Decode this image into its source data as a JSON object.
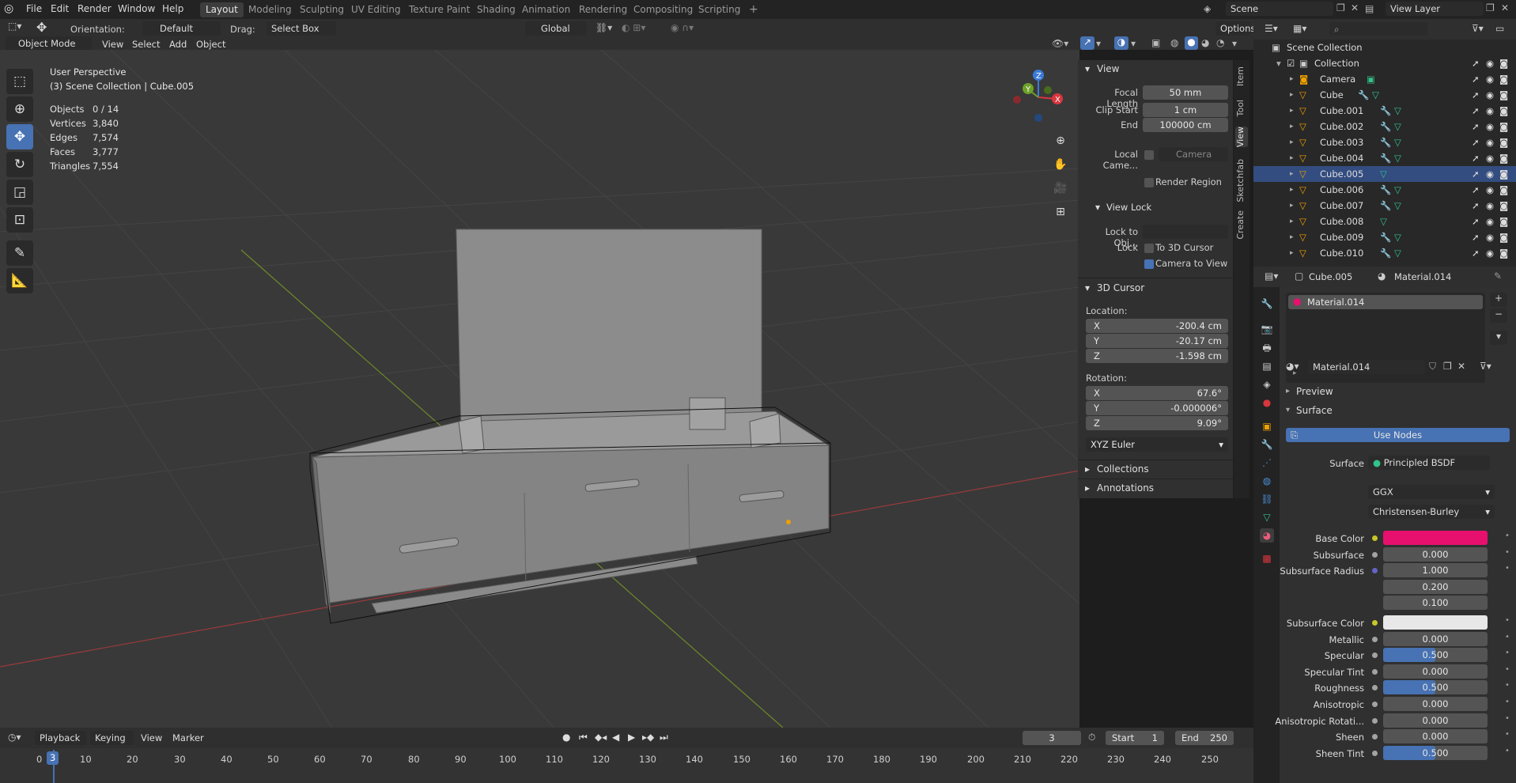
{
  "topbar": {
    "menus": [
      "File",
      "Edit",
      "Render",
      "Window",
      "Help"
    ],
    "workspaces": [
      "Layout",
      "Modeling",
      "Sculpting",
      "UV Editing",
      "Texture Paint",
      "Shading",
      "Animation",
      "Rendering",
      "Compositing",
      "Scripting"
    ],
    "active_workspace": "Layout",
    "add_workspace": "+",
    "scene": "Scene",
    "view_layer": "View Layer"
  },
  "toolsettings": {
    "orientation_label": "Orientation:",
    "orientation_value": "Default",
    "drag_label": "Drag:",
    "drag_value": "Select Box",
    "transform_orientation": "Global",
    "options": "Options"
  },
  "viewport_header": {
    "mode": "Object Mode",
    "menus": [
      "View",
      "Select",
      "Add",
      "Object"
    ]
  },
  "overlay_text": {
    "perspective": "User Perspective",
    "collection": "(3) Scene Collection | Cube.005"
  },
  "stats": [
    {
      "label": "Objects",
      "value": "0 / 14"
    },
    {
      "label": "Vertices",
      "value": "3,840"
    },
    {
      "label": "Edges",
      "value": "7,574"
    },
    {
      "label": "Faces",
      "value": "3,777"
    },
    {
      "label": "Triangles",
      "value": "7,554"
    }
  ],
  "gizmo": {
    "x": "X",
    "y": "Y",
    "z": "Z"
  },
  "npanel": {
    "view_title": "View",
    "focal_length_label": "Focal Length",
    "focal_length": "50 mm",
    "clip_start_label": "Clip Start",
    "clip_start": "1 cm",
    "end_label": "End",
    "end": "100000 cm",
    "local_camera_label": "Local Came...",
    "local_camera_value": "Camera",
    "render_region": "Render Region",
    "view_lock_title": "View Lock",
    "lock_to_obj_label": "Lock to Obj...",
    "lock_label": "Lock",
    "to_3d_cursor": "To 3D Cursor",
    "camera_to_view": "Camera to View",
    "cursor_title": "3D Cursor",
    "location_label": "Location:",
    "loc_x": "-200.4 cm",
    "loc_y": "-20.17 cm",
    "loc_z": "-1.598 cm",
    "rotation_label": "Rotation:",
    "rot_x": "67.6°",
    "rot_y": "-0.000006°",
    "rot_z": "9.09°",
    "rotation_mode": "XYZ Euler",
    "x": "X",
    "y": "Y",
    "z": "Z",
    "collections_title": "Collections",
    "annotations_title": "Annotations",
    "tabs": [
      "Item",
      "Tool",
      "View",
      "Sketchfab",
      "Create"
    ]
  },
  "outliner": {
    "root": "Scene Collection",
    "collection": "Collection",
    "items": [
      "Camera",
      "Cube",
      "Cube.001",
      "Cube.002",
      "Cube.003",
      "Cube.004",
      "Cube.005",
      "Cube.006",
      "Cube.007",
      "Cube.008",
      "Cube.009",
      "Cube.010"
    ]
  },
  "properties": {
    "object_name": "Cube.005",
    "material_name": "Material.014",
    "slot_name": "Material.014",
    "data_block": "Material.014",
    "preview_title": "Preview",
    "surface_title": "Surface",
    "use_nodes": "Use Nodes",
    "surface_label": "Surface",
    "surface_shader": "Principled BSDF",
    "distribution": "GGX",
    "subsurface_method": "Christensen-Burley",
    "rows": [
      {
        "label": "Base Color",
        "value": "",
        "color": "#e8106e"
      },
      {
        "label": "Subsurface",
        "value": "0.000"
      },
      {
        "label": "Subsurface Radius",
        "value": "1.000"
      },
      {
        "label": "",
        "value": "0.200"
      },
      {
        "label": "",
        "value": "0.100"
      },
      {
        "label": "Subsurface Color",
        "value": "",
        "color": "#e8e8e8"
      },
      {
        "label": "Metallic",
        "value": "0.000"
      },
      {
        "label": "Specular",
        "value": "0.500",
        "fill": 0.5
      },
      {
        "label": "Specular Tint",
        "value": "0.000"
      },
      {
        "label": "Roughness",
        "value": "0.500",
        "fill": 0.5
      },
      {
        "label": "Anisotropic",
        "value": "0.000"
      },
      {
        "label": "Anisotropic Rotati...",
        "value": "0.000"
      },
      {
        "label": "Sheen",
        "value": "0.000"
      },
      {
        "label": "Sheen Tint",
        "value": "0.500",
        "fill": 0.5
      }
    ]
  },
  "timeline": {
    "menus": [
      "Playback",
      "Keying",
      "View",
      "Marker"
    ],
    "current_frame": "3",
    "start_label": "Start",
    "start": "1",
    "end_label": "End",
    "end": "250",
    "ticks": [
      "0",
      "10",
      "20",
      "30",
      "40",
      "50",
      "60",
      "70",
      "80",
      "90",
      "100",
      "110",
      "120",
      "130",
      "140",
      "150",
      "160",
      "170",
      "180",
      "190",
      "200",
      "210",
      "220",
      "230",
      "240",
      "250"
    ],
    "playhead": "3"
  },
  "colors": {
    "accent": "#4772b3",
    "base_color": "#e8106e"
  }
}
